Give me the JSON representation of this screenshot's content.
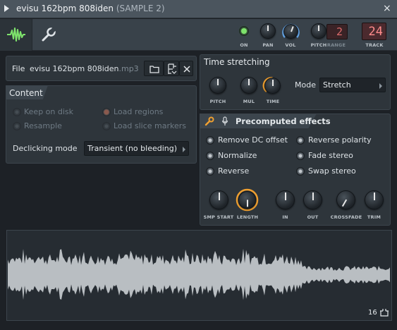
{
  "window": {
    "title": "evisu 162bpm 808iden",
    "subtitle": "(SAMPLE 2)",
    "close": "×"
  },
  "toolbar": {
    "on_label": "ON",
    "pan_label": "PAN",
    "vol_label": "VOL",
    "pitch_label": "PITCH",
    "range_label": "RANGE",
    "range_value": "2",
    "track_label": "TRACK",
    "track_value": "24",
    "colors": {
      "on_led": "#7ee36c",
      "vol_ring": "#6fb6ff",
      "range_display": "#d96a6a"
    }
  },
  "file": {
    "label": "File",
    "name": "evisu 162bpm 808iden",
    "ext": ".mp3"
  },
  "content": {
    "title": "Content",
    "options": [
      {
        "label": "Keep on disk",
        "enabled": false,
        "checked": false
      },
      {
        "label": "Load regions",
        "enabled": false,
        "checked": true
      },
      {
        "label": "Resample",
        "enabled": false,
        "checked": false
      },
      {
        "label": "Load slice markers",
        "enabled": false,
        "checked": false
      }
    ],
    "declicking_label": "Declicking mode",
    "declicking_value": "Transient (no bleeding)"
  },
  "time_stretching": {
    "title": "Time stretching",
    "pitch_label": "PITCH",
    "mul_label": "MUL",
    "time_label": "TIME",
    "mode_label": "Mode",
    "mode_value": "Stretch"
  },
  "precomputed": {
    "title": "Precomputed effects",
    "options": [
      {
        "label": "Remove DC offset"
      },
      {
        "label": "Reverse polarity"
      },
      {
        "label": "Normalize"
      },
      {
        "label": "Fade stereo"
      },
      {
        "label": "Reverse"
      },
      {
        "label": "Swap stereo"
      }
    ],
    "knobs": [
      "SMP START",
      "LENGTH",
      "IN",
      "OUT",
      "CROSSFADE",
      "TRIM"
    ],
    "accent": "#f0a030"
  },
  "waveform": {
    "zoom_value": "16"
  }
}
